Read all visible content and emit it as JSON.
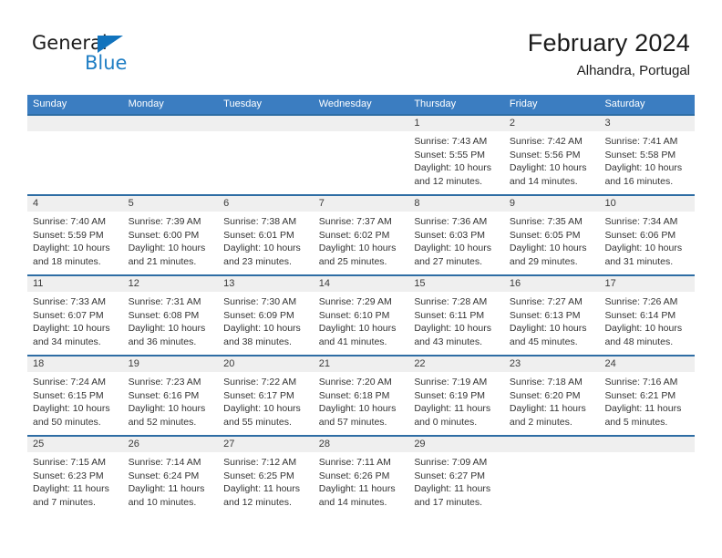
{
  "brand": {
    "name_top": "General",
    "name_bottom": "Blue",
    "triangle_color": "#1173bd",
    "blue_color": "#1f7ec4"
  },
  "header": {
    "title": "February 2024",
    "subtitle": "Alhandra, Portugal"
  },
  "theme": {
    "header_bg": "#3b7dc1",
    "row_divider": "#2e6da4",
    "day_strip_bg": "#efefef",
    "text": "#333333"
  },
  "weekdays": [
    "Sunday",
    "Monday",
    "Tuesday",
    "Wednesday",
    "Thursday",
    "Friday",
    "Saturday"
  ],
  "labels": {
    "sunrise": "Sunrise:",
    "sunset": "Sunset:",
    "daylight": "Daylight:"
  },
  "weeks": [
    [
      {
        "day": "",
        "empty": true
      },
      {
        "day": "",
        "empty": true
      },
      {
        "day": "",
        "empty": true
      },
      {
        "day": "",
        "empty": true
      },
      {
        "day": "1",
        "sunrise": "Sunrise: 7:43 AM",
        "sunset": "Sunset: 5:55 PM",
        "daylight1": "Daylight: 10 hours",
        "daylight2": "and 12 minutes."
      },
      {
        "day": "2",
        "sunrise": "Sunrise: 7:42 AM",
        "sunset": "Sunset: 5:56 PM",
        "daylight1": "Daylight: 10 hours",
        "daylight2": "and 14 minutes."
      },
      {
        "day": "3",
        "sunrise": "Sunrise: 7:41 AM",
        "sunset": "Sunset: 5:58 PM",
        "daylight1": "Daylight: 10 hours",
        "daylight2": "and 16 minutes."
      }
    ],
    [
      {
        "day": "4",
        "sunrise": "Sunrise: 7:40 AM",
        "sunset": "Sunset: 5:59 PM",
        "daylight1": "Daylight: 10 hours",
        "daylight2": "and 18 minutes."
      },
      {
        "day": "5",
        "sunrise": "Sunrise: 7:39 AM",
        "sunset": "Sunset: 6:00 PM",
        "daylight1": "Daylight: 10 hours",
        "daylight2": "and 21 minutes."
      },
      {
        "day": "6",
        "sunrise": "Sunrise: 7:38 AM",
        "sunset": "Sunset: 6:01 PM",
        "daylight1": "Daylight: 10 hours",
        "daylight2": "and 23 minutes."
      },
      {
        "day": "7",
        "sunrise": "Sunrise: 7:37 AM",
        "sunset": "Sunset: 6:02 PM",
        "daylight1": "Daylight: 10 hours",
        "daylight2": "and 25 minutes."
      },
      {
        "day": "8",
        "sunrise": "Sunrise: 7:36 AM",
        "sunset": "Sunset: 6:03 PM",
        "daylight1": "Daylight: 10 hours",
        "daylight2": "and 27 minutes."
      },
      {
        "day": "9",
        "sunrise": "Sunrise: 7:35 AM",
        "sunset": "Sunset: 6:05 PM",
        "daylight1": "Daylight: 10 hours",
        "daylight2": "and 29 minutes."
      },
      {
        "day": "10",
        "sunrise": "Sunrise: 7:34 AM",
        "sunset": "Sunset: 6:06 PM",
        "daylight1": "Daylight: 10 hours",
        "daylight2": "and 31 minutes."
      }
    ],
    [
      {
        "day": "11",
        "sunrise": "Sunrise: 7:33 AM",
        "sunset": "Sunset: 6:07 PM",
        "daylight1": "Daylight: 10 hours",
        "daylight2": "and 34 minutes."
      },
      {
        "day": "12",
        "sunrise": "Sunrise: 7:31 AM",
        "sunset": "Sunset: 6:08 PM",
        "daylight1": "Daylight: 10 hours",
        "daylight2": "and 36 minutes."
      },
      {
        "day": "13",
        "sunrise": "Sunrise: 7:30 AM",
        "sunset": "Sunset: 6:09 PM",
        "daylight1": "Daylight: 10 hours",
        "daylight2": "and 38 minutes."
      },
      {
        "day": "14",
        "sunrise": "Sunrise: 7:29 AM",
        "sunset": "Sunset: 6:10 PM",
        "daylight1": "Daylight: 10 hours",
        "daylight2": "and 41 minutes."
      },
      {
        "day": "15",
        "sunrise": "Sunrise: 7:28 AM",
        "sunset": "Sunset: 6:11 PM",
        "daylight1": "Daylight: 10 hours",
        "daylight2": "and 43 minutes."
      },
      {
        "day": "16",
        "sunrise": "Sunrise: 7:27 AM",
        "sunset": "Sunset: 6:13 PM",
        "daylight1": "Daylight: 10 hours",
        "daylight2": "and 45 minutes."
      },
      {
        "day": "17",
        "sunrise": "Sunrise: 7:26 AM",
        "sunset": "Sunset: 6:14 PM",
        "daylight1": "Daylight: 10 hours",
        "daylight2": "and 48 minutes."
      }
    ],
    [
      {
        "day": "18",
        "sunrise": "Sunrise: 7:24 AM",
        "sunset": "Sunset: 6:15 PM",
        "daylight1": "Daylight: 10 hours",
        "daylight2": "and 50 minutes."
      },
      {
        "day": "19",
        "sunrise": "Sunrise: 7:23 AM",
        "sunset": "Sunset: 6:16 PM",
        "daylight1": "Daylight: 10 hours",
        "daylight2": "and 52 minutes."
      },
      {
        "day": "20",
        "sunrise": "Sunrise: 7:22 AM",
        "sunset": "Sunset: 6:17 PM",
        "daylight1": "Daylight: 10 hours",
        "daylight2": "and 55 minutes."
      },
      {
        "day": "21",
        "sunrise": "Sunrise: 7:20 AM",
        "sunset": "Sunset: 6:18 PM",
        "daylight1": "Daylight: 10 hours",
        "daylight2": "and 57 minutes."
      },
      {
        "day": "22",
        "sunrise": "Sunrise: 7:19 AM",
        "sunset": "Sunset: 6:19 PM",
        "daylight1": "Daylight: 11 hours",
        "daylight2": "and 0 minutes."
      },
      {
        "day": "23",
        "sunrise": "Sunrise: 7:18 AM",
        "sunset": "Sunset: 6:20 PM",
        "daylight1": "Daylight: 11 hours",
        "daylight2": "and 2 minutes."
      },
      {
        "day": "24",
        "sunrise": "Sunrise: 7:16 AM",
        "sunset": "Sunset: 6:21 PM",
        "daylight1": "Daylight: 11 hours",
        "daylight2": "and 5 minutes."
      }
    ],
    [
      {
        "day": "25",
        "sunrise": "Sunrise: 7:15 AM",
        "sunset": "Sunset: 6:23 PM",
        "daylight1": "Daylight: 11 hours",
        "daylight2": "and 7 minutes."
      },
      {
        "day": "26",
        "sunrise": "Sunrise: 7:14 AM",
        "sunset": "Sunset: 6:24 PM",
        "daylight1": "Daylight: 11 hours",
        "daylight2": "and 10 minutes."
      },
      {
        "day": "27",
        "sunrise": "Sunrise: 7:12 AM",
        "sunset": "Sunset: 6:25 PM",
        "daylight1": "Daylight: 11 hours",
        "daylight2": "and 12 minutes."
      },
      {
        "day": "28",
        "sunrise": "Sunrise: 7:11 AM",
        "sunset": "Sunset: 6:26 PM",
        "daylight1": "Daylight: 11 hours",
        "daylight2": "and 14 minutes."
      },
      {
        "day": "29",
        "sunrise": "Sunrise: 7:09 AM",
        "sunset": "Sunset: 6:27 PM",
        "daylight1": "Daylight: 11 hours",
        "daylight2": "and 17 minutes."
      },
      {
        "day": "",
        "empty": true
      },
      {
        "day": "",
        "empty": true
      }
    ]
  ]
}
